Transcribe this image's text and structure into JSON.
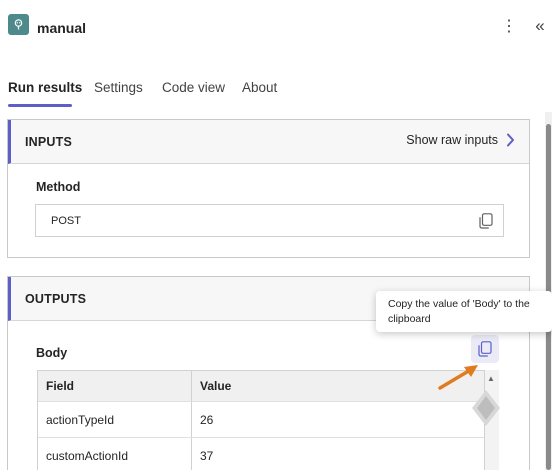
{
  "header": {
    "title": "manual",
    "more_glyph": "⋮",
    "collapse_glyph": "«",
    "icon": "robot-icon"
  },
  "tabs": [
    {
      "label": "Run results",
      "active": true
    },
    {
      "label": "Settings",
      "active": false
    },
    {
      "label": "Code view",
      "active": false
    },
    {
      "label": "About",
      "active": false
    }
  ],
  "inputs": {
    "section_label": "INPUTS",
    "raw_link": "Show raw inputs",
    "method_label": "Method",
    "method_value": "POST"
  },
  "outputs": {
    "section_label": "OUTPUTS",
    "body_label": "Body",
    "tooltip": "Copy the value of 'Body' to the clipboard",
    "table": {
      "headers": [
        "Field",
        "Value"
      ],
      "rows": [
        [
          "actionTypeId",
          "26"
        ],
        [
          "customActionId",
          "37"
        ]
      ]
    }
  },
  "colors": {
    "accent": "#5b5fc7",
    "arrow": "#e07b1f",
    "app_icon": "#4f8a8b"
  }
}
